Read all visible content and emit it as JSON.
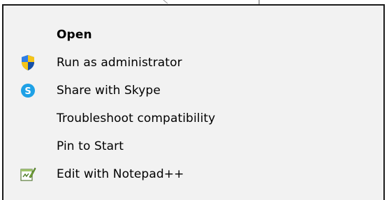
{
  "context_menu": {
    "items": [
      {
        "label": "Open",
        "bold": true,
        "icon": ""
      },
      {
        "label": "Run as administrator",
        "bold": false,
        "icon": "uac-shield-icon"
      },
      {
        "label": "Share with Skype",
        "bold": false,
        "icon": "skype-icon"
      },
      {
        "label": "Troubleshoot compatibility",
        "bold": false,
        "icon": ""
      },
      {
        "label": "Pin to Start",
        "bold": false,
        "icon": ""
      },
      {
        "label": "Edit with Notepad++",
        "bold": false,
        "icon": "notepadpp-icon"
      }
    ]
  },
  "colors": {
    "menu_bg": "#f2f2f2",
    "border": "#1a1a1a",
    "text": "#000000",
    "skype_blue": "#1ea1e6",
    "shield_blue": "#1e63c8",
    "shield_yellow": "#f5c518"
  }
}
